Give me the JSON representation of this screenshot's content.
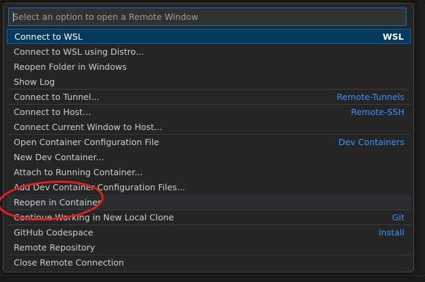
{
  "quick_pick": {
    "placeholder": "Select an option to open a Remote Window",
    "value": ""
  },
  "items": [
    {
      "label": "Connect to WSL",
      "detail": "WSL"
    },
    {
      "label": "Connect to WSL using Distro...",
      "detail": ""
    },
    {
      "label": "Reopen Folder in Windows",
      "detail": ""
    },
    {
      "label": "Show Log",
      "detail": ""
    },
    {
      "label": "Connect to Tunnel...",
      "detail": "Remote-Tunnels"
    },
    {
      "label": "Connect to Host...",
      "detail": "Remote-SSH"
    },
    {
      "label": "Connect Current Window to Host...",
      "detail": ""
    },
    {
      "label": "Open Container Configuration File",
      "detail": "Dev Containers"
    },
    {
      "label": "New Dev Container...",
      "detail": ""
    },
    {
      "label": "Attach to Running Container...",
      "detail": ""
    },
    {
      "label": "Add Dev Container Configuration Files...",
      "detail": ""
    },
    {
      "label": "Reopen in Container",
      "detail": ""
    },
    {
      "label": "Continue Working in New Local Clone",
      "detail": "Git"
    },
    {
      "label": "GitHub Codespace",
      "detail": "Install"
    },
    {
      "label": "Remote Repository",
      "detail": ""
    },
    {
      "label": "Close Remote Connection",
      "detail": ""
    }
  ],
  "colors": {
    "accent": "#0078d4",
    "selected_background": "#04395e",
    "detail_text": "#3794ff",
    "annotation": "#e0201f"
  }
}
